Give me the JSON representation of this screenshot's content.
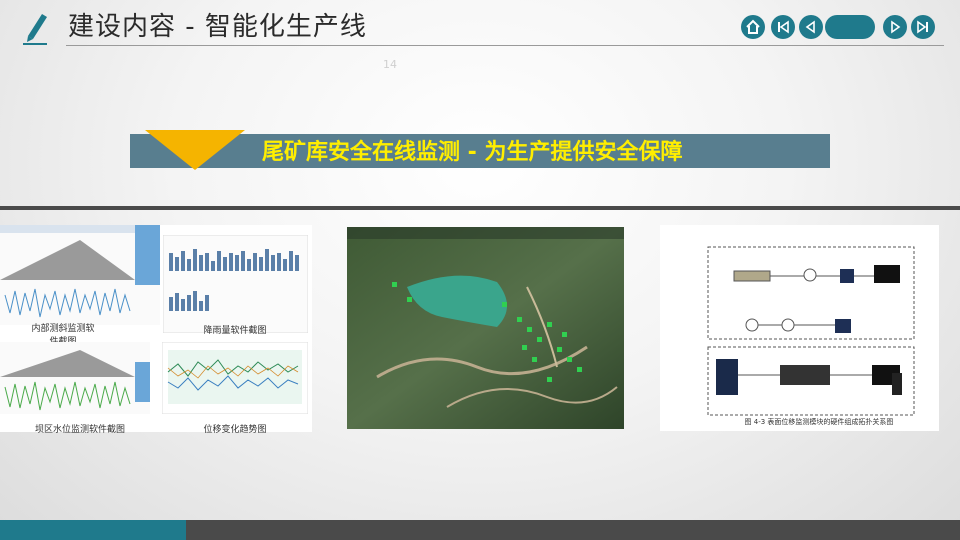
{
  "header": {
    "title": "建设内容 - 智能化生产线"
  },
  "nav": {
    "home_icon": "home-icon",
    "first_icon": "skip-back-icon",
    "prev_icon": "prev-icon",
    "next_icon": "next-icon",
    "last_icon": "skip-forward-icon"
  },
  "page_number": "14",
  "banner": {
    "text": "尾矿库安全在线监测 - 为生产提供安全保障"
  },
  "left_panel": {
    "captions": [
      "内部测斜监测软件截图",
      "降雨量软件截图",
      "坝区水位监测软件截图",
      "位移变化趋势图"
    ]
  },
  "right_panel": {
    "caption": "图 4-3 表面位移监测模块的硬件组成拓扑关系图"
  },
  "colors": {
    "accent": "#1f7a8c",
    "banner_bg": "#587e8f",
    "banner_text": "#ffee00",
    "triangle": "#f5b400",
    "dark_bar": "#4a4a4a"
  }
}
